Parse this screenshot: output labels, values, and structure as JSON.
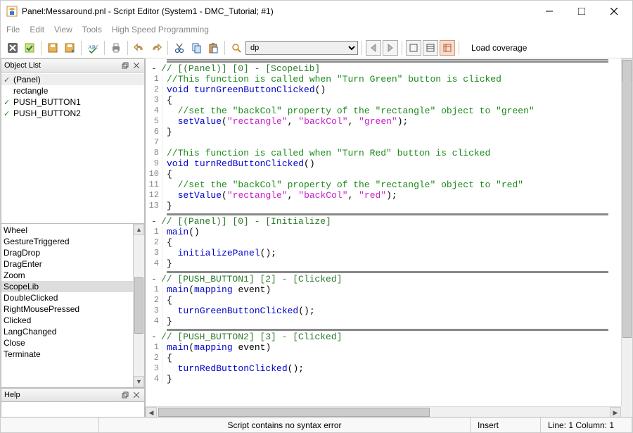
{
  "window": {
    "title": "Panel:Messaround.pnl - Script Editor (System1 - DMC_Tutorial; #1)"
  },
  "menu": {
    "file": "File",
    "edit": "Edit",
    "view": "View",
    "tools": "Tools",
    "hsp": "High Speed Programming"
  },
  "toolbar": {
    "combo_value": "dp",
    "load_coverage": "Load coverage"
  },
  "panels": {
    "object_list_title": "Object List",
    "help_title": "Help"
  },
  "objects": [
    {
      "label": "(Panel)",
      "checked": true,
      "selected": true
    },
    {
      "label": "rectangle",
      "checked": false,
      "selected": false
    },
    {
      "label": "PUSH_BUTTON1",
      "checked": true,
      "selected": false
    },
    {
      "label": "PUSH_BUTTON2",
      "checked": true,
      "selected": false
    }
  ],
  "events": [
    {
      "label": "Wheel",
      "selected": false
    },
    {
      "label": "GestureTriggered",
      "selected": false
    },
    {
      "label": "DragDrop",
      "selected": false
    },
    {
      "label": "DragEnter",
      "selected": false
    },
    {
      "label": "Zoom",
      "selected": false
    },
    {
      "label": "ScopeLib",
      "selected": true
    },
    {
      "label": "DoubleClicked",
      "selected": false
    },
    {
      "label": "RightMousePressed",
      "selected": false
    },
    {
      "label": "Clicked",
      "selected": false
    },
    {
      "label": "LangChanged",
      "selected": false
    },
    {
      "label": "Close",
      "selected": false
    },
    {
      "label": "Terminate",
      "selected": false
    }
  ],
  "code_sections": [
    {
      "header": "// [(Panel)] [0] - [ScopeLib]",
      "lines": [
        [
          {
            "cls": "c-comment",
            "t": "//This function is called when \"Turn Green\" button is clicked"
          }
        ],
        [
          {
            "cls": "c-keyword",
            "t": "void "
          },
          {
            "cls": "c-func",
            "t": "turnGreenButtonClicked"
          },
          {
            "cls": "c-plain",
            "t": "()"
          }
        ],
        [
          {
            "cls": "c-plain",
            "t": "{"
          }
        ],
        [
          {
            "cls": "c-plain",
            "t": "  "
          },
          {
            "cls": "c-comment",
            "t": "//set the \"backCol\" property of the \"rectangle\" object to \"green\""
          }
        ],
        [
          {
            "cls": "c-plain",
            "t": "  "
          },
          {
            "cls": "c-func",
            "t": "setValue"
          },
          {
            "cls": "c-plain",
            "t": "("
          },
          {
            "cls": "c-string",
            "t": "\"rectangle\""
          },
          {
            "cls": "c-plain",
            "t": ", "
          },
          {
            "cls": "c-string",
            "t": "\"backCol\""
          },
          {
            "cls": "c-plain",
            "t": ", "
          },
          {
            "cls": "c-string",
            "t": "\"green\""
          },
          {
            "cls": "c-plain",
            "t": ");"
          }
        ],
        [
          {
            "cls": "c-plain",
            "t": "}"
          }
        ],
        [
          {
            "cls": "c-plain",
            "t": ""
          }
        ],
        [
          {
            "cls": "c-comment",
            "t": "//This function is called when \"Turn Red\" button is clicked"
          }
        ],
        [
          {
            "cls": "c-keyword",
            "t": "void "
          },
          {
            "cls": "c-func",
            "t": "turnRedButtonClicked"
          },
          {
            "cls": "c-plain",
            "t": "()"
          }
        ],
        [
          {
            "cls": "c-plain",
            "t": "{"
          }
        ],
        [
          {
            "cls": "c-plain",
            "t": "  "
          },
          {
            "cls": "c-comment",
            "t": "//set the \"backCol\" property of the \"rectangle\" object to \"red\""
          }
        ],
        [
          {
            "cls": "c-plain",
            "t": "  "
          },
          {
            "cls": "c-func",
            "t": "setValue"
          },
          {
            "cls": "c-plain",
            "t": "("
          },
          {
            "cls": "c-string",
            "t": "\"rectangle\""
          },
          {
            "cls": "c-plain",
            "t": ", "
          },
          {
            "cls": "c-string",
            "t": "\"backCol\""
          },
          {
            "cls": "c-plain",
            "t": ", "
          },
          {
            "cls": "c-string",
            "t": "\"red\""
          },
          {
            "cls": "c-plain",
            "t": ");"
          }
        ],
        [
          {
            "cls": "c-plain",
            "t": "}"
          }
        ]
      ]
    },
    {
      "header": "// [(Panel)] [0] - [Initialize]",
      "lines": [
        [
          {
            "cls": "c-func",
            "t": "main"
          },
          {
            "cls": "c-plain",
            "t": "()"
          }
        ],
        [
          {
            "cls": "c-plain",
            "t": "{"
          }
        ],
        [
          {
            "cls": "c-plain",
            "t": "  "
          },
          {
            "cls": "c-func",
            "t": "initializePanel"
          },
          {
            "cls": "c-plain",
            "t": "();"
          }
        ],
        [
          {
            "cls": "c-plain",
            "t": "}"
          }
        ]
      ]
    },
    {
      "header": "// [PUSH_BUTTON1] [2] - [Clicked]",
      "lines": [
        [
          {
            "cls": "c-func",
            "t": "main"
          },
          {
            "cls": "c-plain",
            "t": "("
          },
          {
            "cls": "c-keyword",
            "t": "mapping"
          },
          {
            "cls": "c-plain",
            "t": " event)"
          }
        ],
        [
          {
            "cls": "c-plain",
            "t": "{"
          }
        ],
        [
          {
            "cls": "c-plain",
            "t": "  "
          },
          {
            "cls": "c-func",
            "t": "turnGreenButtonClicked"
          },
          {
            "cls": "c-plain",
            "t": "();"
          }
        ],
        [
          {
            "cls": "c-plain",
            "t": "}"
          }
        ]
      ]
    },
    {
      "header": "// [PUSH_BUTTON2] [3] - [Clicked]",
      "lines": [
        [
          {
            "cls": "c-func",
            "t": "main"
          },
          {
            "cls": "c-plain",
            "t": "("
          },
          {
            "cls": "c-keyword",
            "t": "mapping"
          },
          {
            "cls": "c-plain",
            "t": " event)"
          }
        ],
        [
          {
            "cls": "c-plain",
            "t": "{"
          }
        ],
        [
          {
            "cls": "c-plain",
            "t": "  "
          },
          {
            "cls": "c-func",
            "t": "turnRedButtonClicked"
          },
          {
            "cls": "c-plain",
            "t": "();"
          }
        ],
        [
          {
            "cls": "c-plain",
            "t": "}"
          }
        ]
      ]
    }
  ],
  "status": {
    "syntax": "Script contains no syntax error",
    "insert": "Insert",
    "position": "Line: 1 Column: 1"
  }
}
